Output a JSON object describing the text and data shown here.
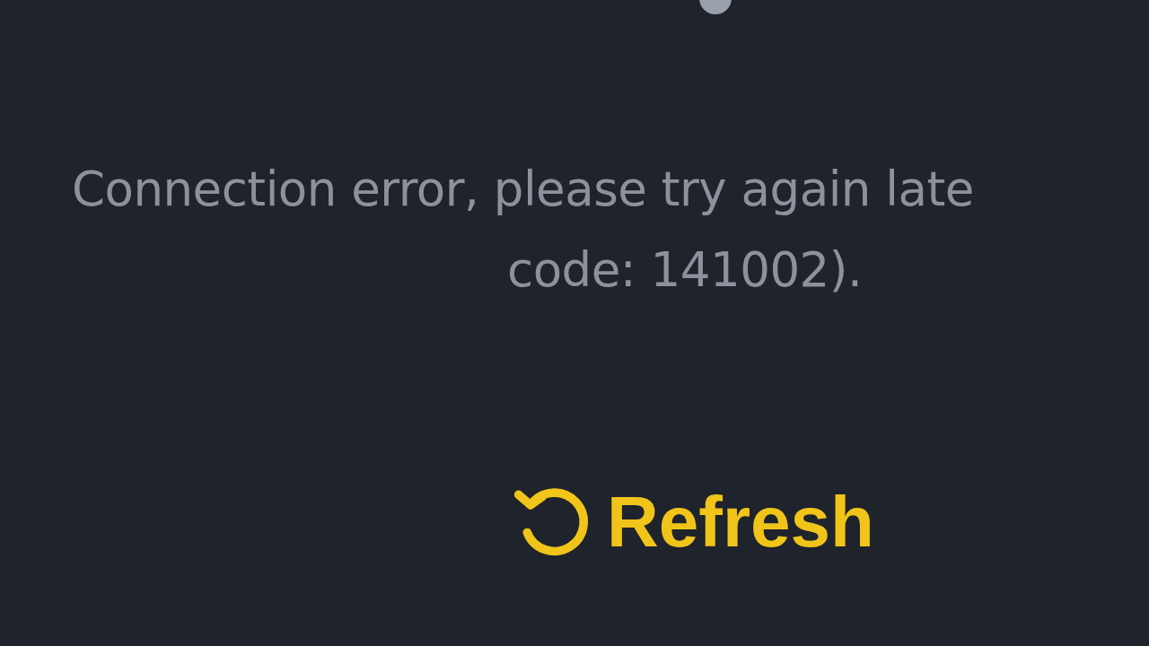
{
  "message_lines": [
    "Connection error, please try again late",
    "code: 141002)."
  ],
  "refresh_button": {
    "label": "Refresh"
  }
}
